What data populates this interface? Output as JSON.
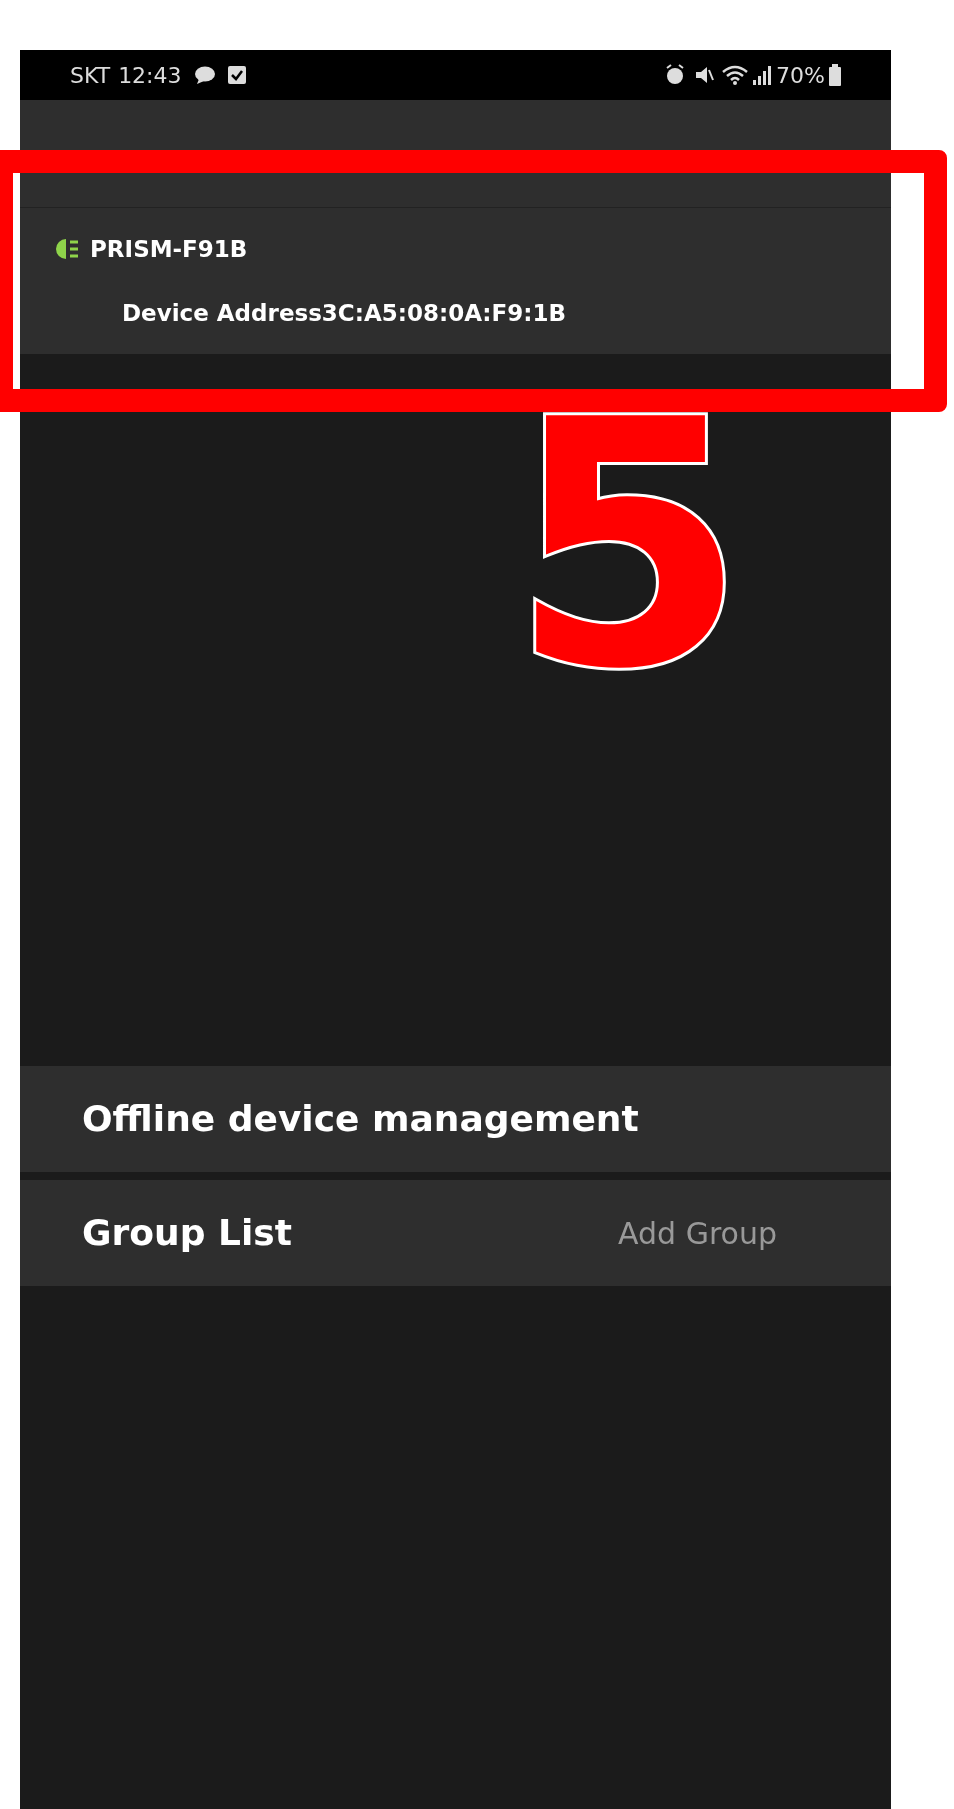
{
  "status_bar": {
    "carrier": "SKT",
    "time": "12:43",
    "battery": "70%"
  },
  "devices": [
    {
      "name": "PRISM-F91B",
      "address": "Device Address3C:A5:08:0A:F9:1B",
      "connected": true
    }
  ],
  "menu": [
    {
      "label": "Offline device management"
    },
    {
      "label": "Group List",
      "action": "Add Group"
    }
  ],
  "annotation": {
    "number": "5"
  }
}
